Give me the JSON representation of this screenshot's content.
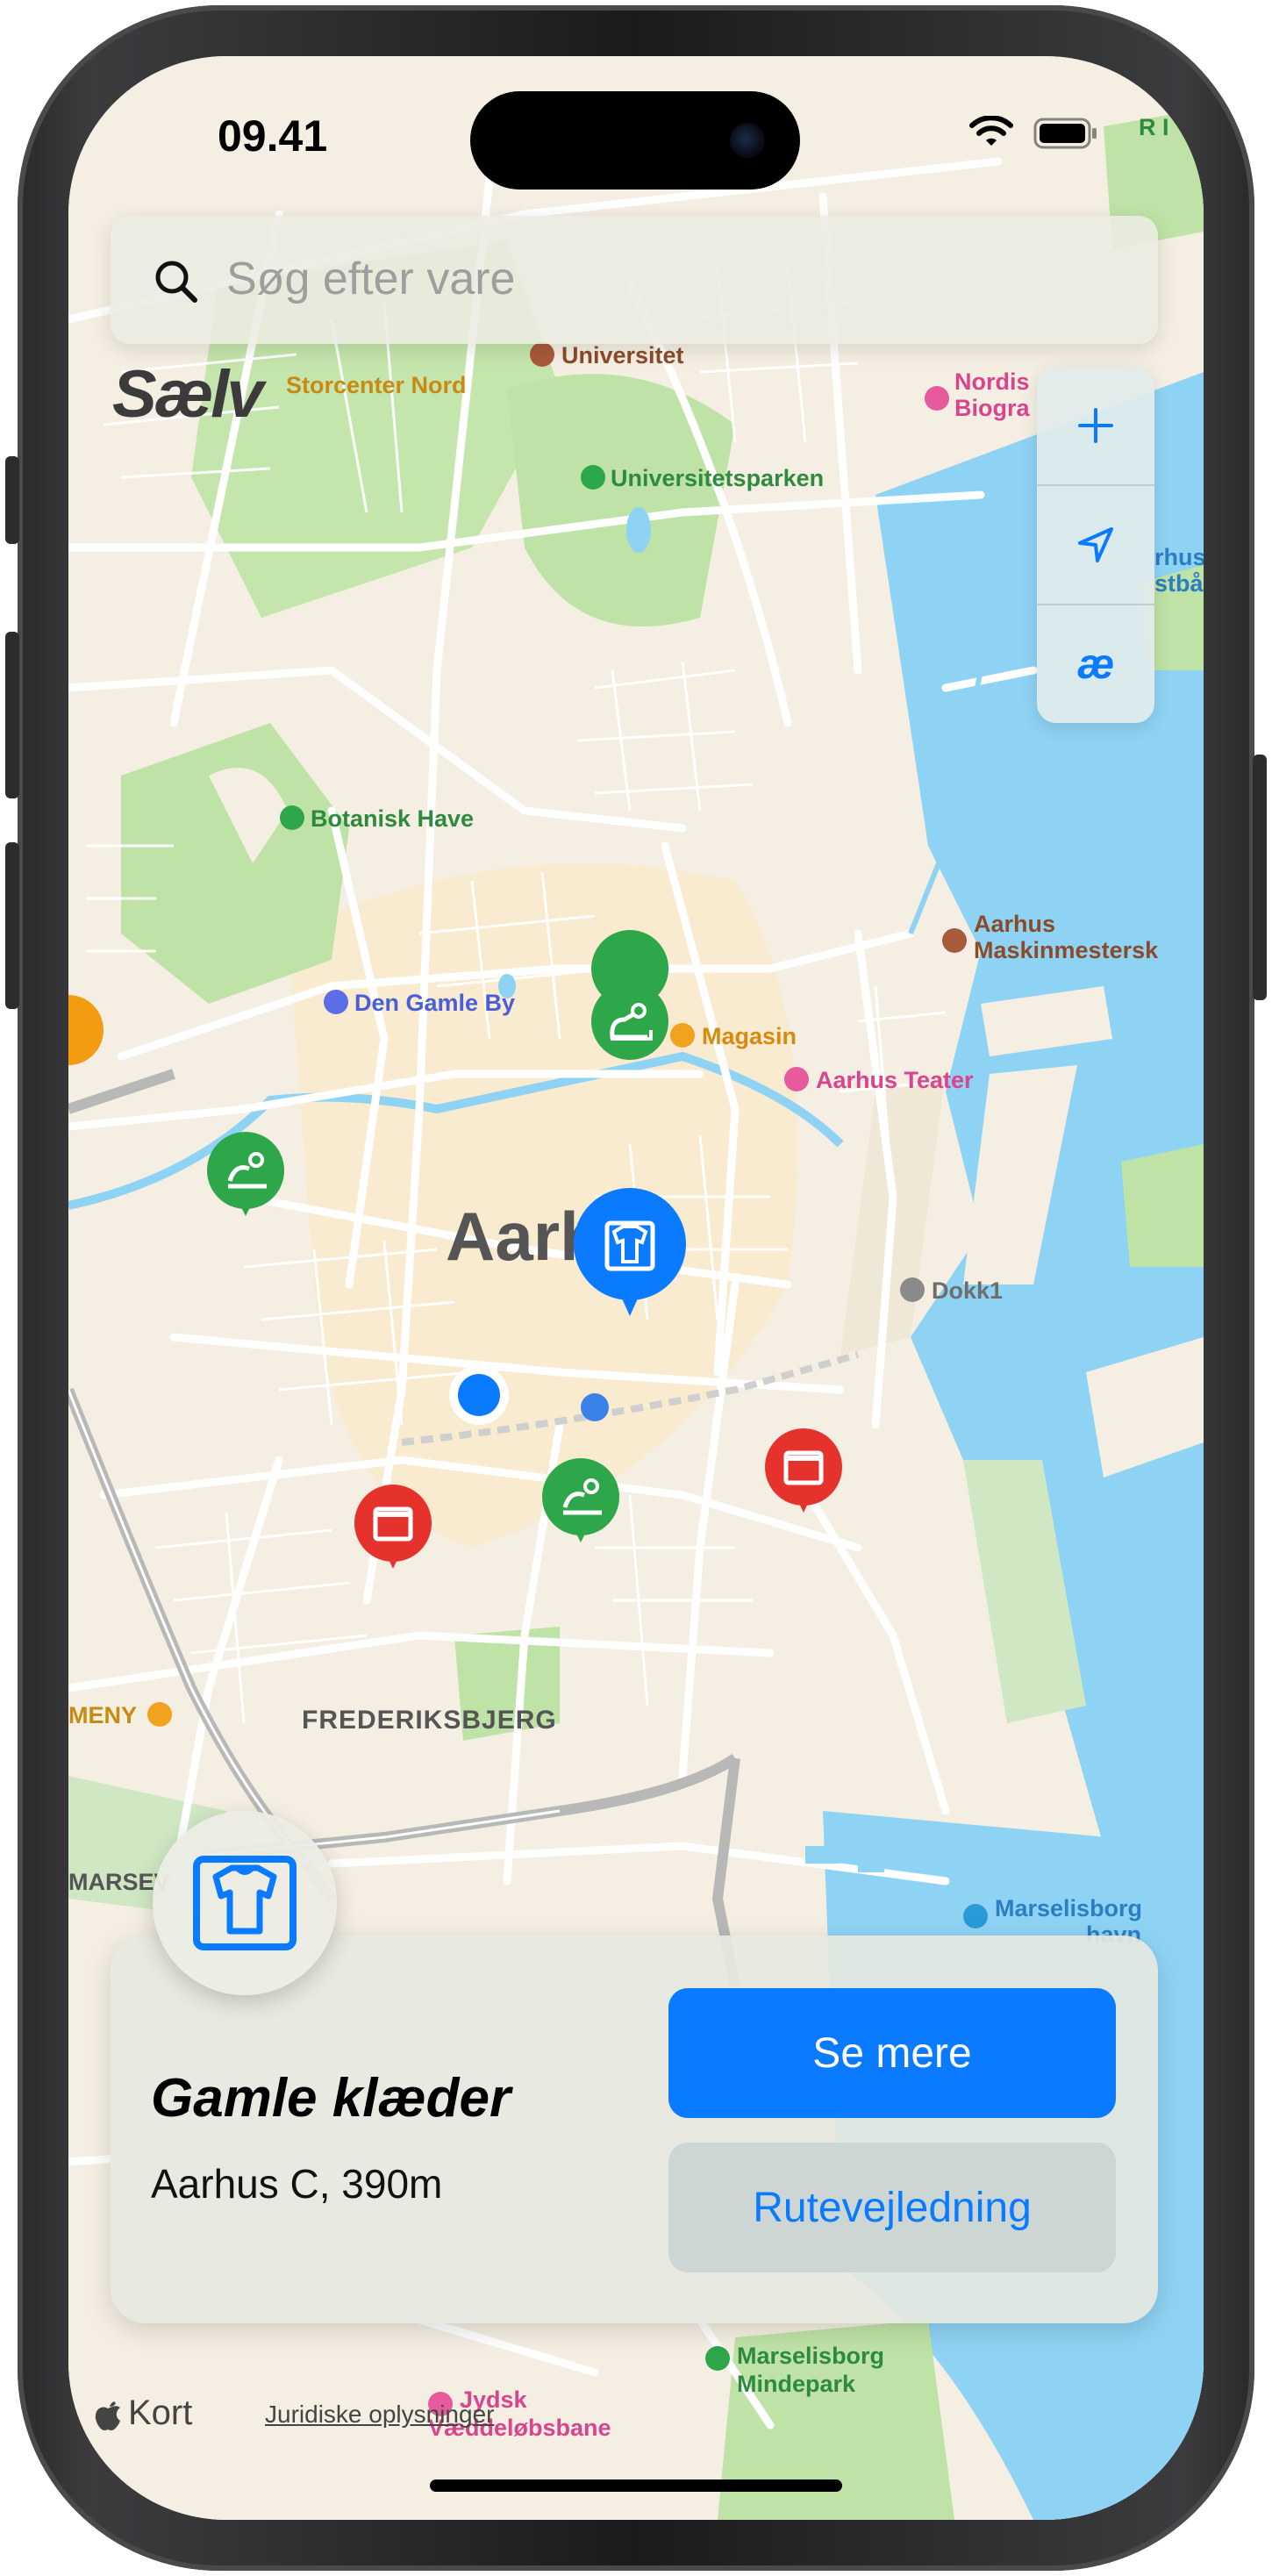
{
  "status_bar": {
    "time": "09.41"
  },
  "search": {
    "placeholder": "Søg efter vare"
  },
  "logo": {
    "text": "Sælv"
  },
  "map_controls": {
    "zoom_icon": "plus-icon",
    "location_icon": "location-arrow-icon",
    "brand_label": "æ"
  },
  "map": {
    "city_label": "Aarhus",
    "district_label": "FREDERIKSBJERG",
    "places": {
      "universitet": "Universitet",
      "storcenter": "Storcenter Nord",
      "nordisk_1": "Nordis",
      "nordisk_2": "Biogra",
      "universitetsparken": "Universitetsparken",
      "aarhus_cut_1": "rhus",
      "aarhus_cut_2": "stbå",
      "botanisk": "Botanisk Have",
      "maskin_1": "Aarhus",
      "maskin_2": "Maskinmestersk",
      "gamle_by": "Den Gamle By",
      "magasin": "Magasin",
      "teater": "Aarhus Teater",
      "dokk1": "Dokk1",
      "menu": "MENY",
      "marsev": "MARSEV",
      "marselisborg_1": "Marselisborg",
      "marselisborg_2": "havn",
      "mindepark_1": "Marselisborg",
      "mindepark_2": "Mindepark",
      "jydsk_1": "Jydsk",
      "jydsk_2": "Væddeløbsbane",
      "ri": "R I"
    }
  },
  "selected_item": {
    "title": "Gamle klæder",
    "subtitle": "Aarhus C, 390m",
    "primary_action": "Se mere",
    "secondary_action": "Rutevejledning",
    "category_icon": "t-shirt-icon"
  },
  "attribution": {
    "brand": "Kort",
    "legal": "Juridiske oplysninger"
  },
  "colors": {
    "accent": "#0a7aff",
    "pin_green": "#2ea64a",
    "pin_red": "#e5322d",
    "water": "#8fd3f4",
    "park": "#bfe3a6"
  }
}
